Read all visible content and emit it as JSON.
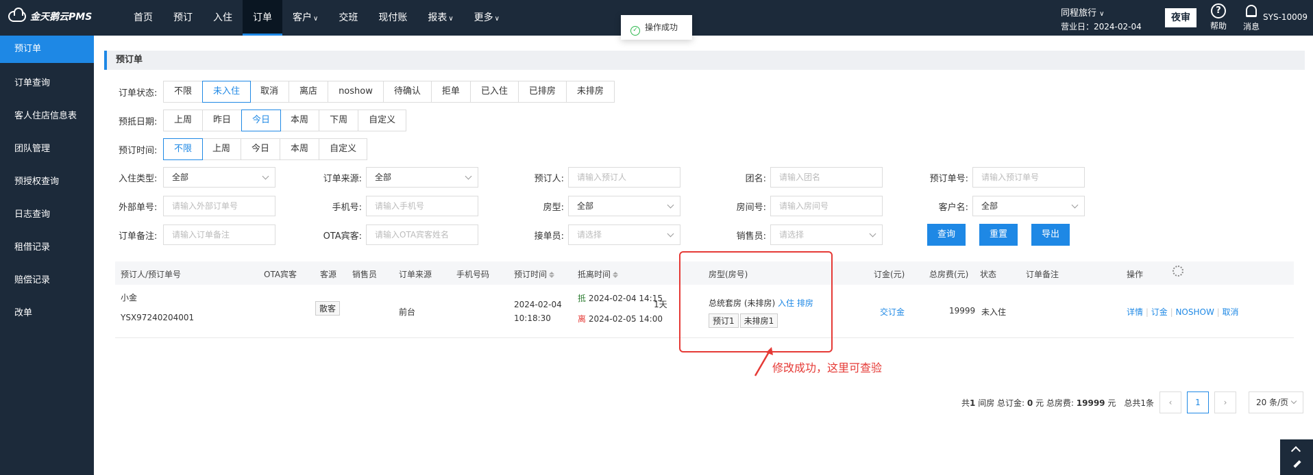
{
  "header": {
    "logo": "金天鹅云PMS",
    "nav": [
      {
        "label": "首页",
        "dropdown": false,
        "active": false
      },
      {
        "label": "预订",
        "dropdown": false,
        "active": false
      },
      {
        "label": "入住",
        "dropdown": false,
        "active": false
      },
      {
        "label": "订单",
        "dropdown": false,
        "active": true
      },
      {
        "label": "客户",
        "dropdown": true,
        "active": false
      },
      {
        "label": "交班",
        "dropdown": false,
        "active": false
      },
      {
        "label": "现付账",
        "dropdown": false,
        "active": false
      },
      {
        "label": "报表",
        "dropdown": true,
        "active": false
      },
      {
        "label": "更多",
        "dropdown": true,
        "active": false
      }
    ],
    "org_name": "同程旅行",
    "business_date": "营业日：2024-02-04",
    "night_audit": "夜审",
    "help_label": "帮助",
    "help_icon_char": "?",
    "msg_label": "消息",
    "user": "SYS-10009"
  },
  "sidebar": {
    "items": [
      {
        "label": "预订单",
        "active": true
      },
      {
        "label": "订单查询",
        "active": false
      },
      {
        "label": "客人住店信息表",
        "active": false
      },
      {
        "label": "团队管理",
        "active": false
      },
      {
        "label": "预授权查询",
        "active": false
      },
      {
        "label": "日志查询",
        "active": false
      },
      {
        "label": "租借记录",
        "active": false
      },
      {
        "label": "赔偿记录",
        "active": false
      },
      {
        "label": "改单",
        "active": false
      }
    ]
  },
  "toast": {
    "text": "操作成功",
    "icon": "✓"
  },
  "page_title": "预订单",
  "filters": {
    "order_status": {
      "label": "订单状态:",
      "options": [
        "不限",
        "未入住",
        "取消",
        "离店",
        "noshow",
        "待确认",
        "拒单",
        "已入住",
        "已排房",
        "未排房"
      ],
      "active": 1
    },
    "arrival_date": {
      "label": "预抵日期:",
      "options": [
        "上周",
        "昨日",
        "今日",
        "本周",
        "下周",
        "自定义"
      ],
      "active": 2
    },
    "booking_time": {
      "label": "预订时间:",
      "options": [
        "不限",
        "上周",
        "今日",
        "本周",
        "自定义"
      ],
      "active": 0
    }
  },
  "fields": {
    "checkin_type": {
      "label": "入住类型:",
      "value": "全部"
    },
    "order_source": {
      "label": "订单来源:",
      "value": "全部"
    },
    "booker": {
      "label": "预订人:",
      "placeholder": "请输入预订人"
    },
    "group_name": {
      "label": "团名:",
      "placeholder": "请输入团名"
    },
    "booking_no": {
      "label": "预订单号:",
      "placeholder": "请输入预订单号"
    },
    "external_no": {
      "label": "外部单号:",
      "placeholder": "请输入外部订单号"
    },
    "phone": {
      "label": "手机号:",
      "placeholder": "请输入手机号"
    },
    "room_type": {
      "label": "房型:",
      "value": "全部"
    },
    "room_no": {
      "label": "房间号:",
      "placeholder": "请输入房间号"
    },
    "customer": {
      "label": "客户名:",
      "value": "全部"
    },
    "remark": {
      "label": "订单备注:",
      "placeholder": "请输入订单备注"
    },
    "ota_guest": {
      "label": "OTA宾客:",
      "placeholder": "请输入OTA宾客姓名"
    },
    "receiver": {
      "label": "接单员:",
      "placeholder": "请选择"
    },
    "sales": {
      "label": "销售员:",
      "placeholder": "请选择"
    }
  },
  "buttons": {
    "search": "查询",
    "reset": "重置",
    "export": "导出"
  },
  "table": {
    "headers": {
      "booker": "预订人/预订单号",
      "ota": "OTA宾客",
      "source_type": "客源",
      "sales": "销售员",
      "order_source": "订单来源",
      "phone": "手机号码",
      "booking_time": "预订时间",
      "arr_dep": "抵离时间",
      "room": "房型(房号)",
      "deposit": "订金(元)",
      "total": "总房费(元)",
      "status": "状态",
      "remark": "订单备注",
      "ops": "操作"
    },
    "rows": [
      {
        "booker": "小金",
        "order_no": "YSX97240204001",
        "source_type": "散客",
        "order_source": "前台",
        "booking_date": "2024-02-04",
        "booking_clock": "10:18:30",
        "arrive_mark": "抵",
        "arrive": "2024-02-04 14:15",
        "depart_mark": "离",
        "depart": "2024-02-05 14:00",
        "nights": "1天",
        "room_type": "总统套房 (未排房)",
        "checkin_link": "入住",
        "assign_link": "排房",
        "tag1": "预订1",
        "tag2": "未排房1",
        "deposit_link": "交订金",
        "total": "19999",
        "status": "未入住",
        "ops": [
          "详情",
          "订金",
          "NOSHOW",
          "取消"
        ]
      }
    ]
  },
  "annotation": "修改成功，这里可查验",
  "pager": {
    "summary_rooms": "共",
    "rooms_num": "1",
    "summary_rooms_unit": "间房 总订金:",
    "deposit_num": "0",
    "summary_deposit_unit": "元 总房费:",
    "total_num": "19999",
    "summary_total_unit": "元",
    "count": "总共1条",
    "current_page": "1",
    "page_size": "20 条/页",
    "prev": "‹",
    "next": "›"
  },
  "colors": {
    "accent": "#1e88e5",
    "header_bg": "#1c2a3a",
    "annotation": "#e53935"
  }
}
